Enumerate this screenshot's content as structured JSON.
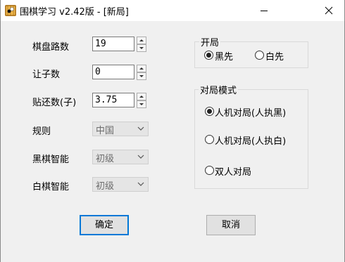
{
  "window": {
    "title": "围棋学习 v2.42版 - [新局]",
    "icons": [
      "app-icon",
      "minimize-icon",
      "close-icon"
    ]
  },
  "settings": {
    "board_size": {
      "label": "棋盘路数",
      "value": "19"
    },
    "handicap": {
      "label": "让子数",
      "value": "0"
    },
    "komi": {
      "label": "贴还数(子)",
      "value": "3.75"
    },
    "rules": {
      "label": "规则",
      "value": "中国"
    },
    "black_ai": {
      "label": "黑棋智能",
      "value": "初级"
    },
    "white_ai": {
      "label": "白棋智能",
      "value": "初级"
    }
  },
  "opening": {
    "title": "开局",
    "options": [
      "黑先",
      "白先"
    ],
    "selected": "黑先"
  },
  "mode": {
    "title": "对局模式",
    "options": [
      "人机对局(人执黑)",
      "人机对局(人执白)",
      "双人对局"
    ],
    "selected": "人机对局(人执黑)"
  },
  "buttons": {
    "ok": "确定",
    "cancel": "取消"
  },
  "colors": {
    "accent": "#0078d7",
    "background": "#f0f0f0"
  }
}
